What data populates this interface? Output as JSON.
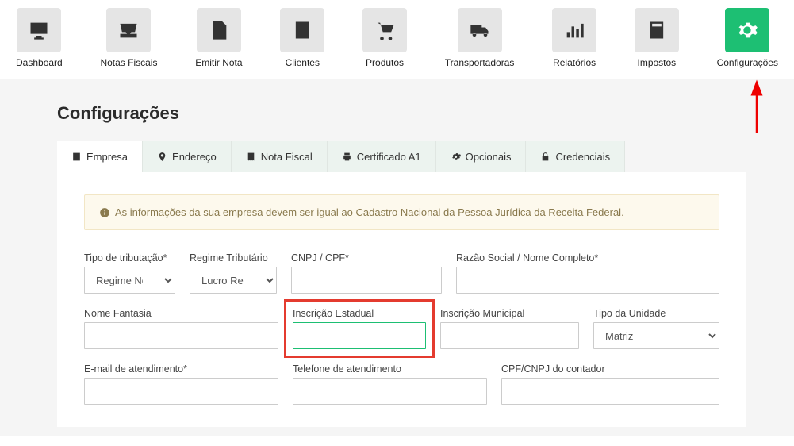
{
  "nav": [
    {
      "id": "dashboard",
      "label": "Dashboard"
    },
    {
      "id": "notas",
      "label": "Notas Fiscais"
    },
    {
      "id": "emitir",
      "label": "Emitir Nota"
    },
    {
      "id": "clientes",
      "label": "Clientes"
    },
    {
      "id": "produtos",
      "label": "Produtos"
    },
    {
      "id": "transportadoras",
      "label": "Transportadoras"
    },
    {
      "id": "relatorios",
      "label": "Relatórios"
    },
    {
      "id": "impostos",
      "label": "Impostos"
    },
    {
      "id": "config",
      "label": "Configurações"
    }
  ],
  "page_title": "Configurações",
  "tabs": [
    {
      "id": "empresa",
      "label": "Empresa"
    },
    {
      "id": "endereco",
      "label": "Endereço"
    },
    {
      "id": "notafiscal",
      "label": "Nota Fiscal"
    },
    {
      "id": "certificado",
      "label": "Certificado A1"
    },
    {
      "id": "opcionais",
      "label": "Opcionais"
    },
    {
      "id": "credenciais",
      "label": "Credenciais"
    }
  ],
  "alert": {
    "prefix": "As informações da sua empresa devem ser igual ao ",
    "link": "Cadastro Nacional da Pessoa Jurídica da Receita Federal."
  },
  "form": {
    "tipo_tributacao": {
      "label": "Tipo de tributação*",
      "value": "Regime No"
    },
    "regime_tributario": {
      "label": "Regime Tributário",
      "value": "Lucro Real"
    },
    "cnpj": {
      "label": "CNPJ / CPF*",
      "value": ""
    },
    "razao": {
      "label": "Razão Social / Nome Completo*",
      "value": ""
    },
    "nome_fantasia": {
      "label": "Nome Fantasia",
      "value": ""
    },
    "inscricao_estadual": {
      "label": "Inscrição Estadual",
      "value": ""
    },
    "inscricao_municipal": {
      "label": "Inscrição Municipal",
      "value": ""
    },
    "tipo_unidade": {
      "label": "Tipo da Unidade",
      "value": "Matriz"
    },
    "email": {
      "label": "E-mail de atendimento*",
      "value": ""
    },
    "telefone": {
      "label": "Telefone de atendimento",
      "value": ""
    },
    "cpf_contador": {
      "label": "CPF/CNPJ do contador",
      "value": ""
    }
  }
}
